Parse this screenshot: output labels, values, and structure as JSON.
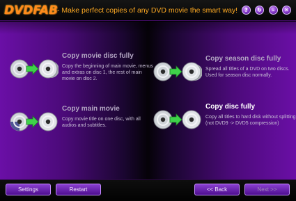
{
  "app": {
    "logo_text": "DVDFAB",
    "tagline": "- Make perfect copies of any DVD movie the smart way!",
    "buttons": {
      "help": "?",
      "refresh": "↻",
      "minimize": "–",
      "close": "✕"
    }
  },
  "options": [
    {
      "title": "Copy movie disc fully",
      "desc": "Copy the beginning of main movie, menus and extras on disc 1, the rest of main movie on disc 2."
    },
    {
      "title": "Copy season disc fully",
      "desc": "Spread all titles of a DVD on two discs. Used for season disc normally."
    },
    {
      "title": "Copy main movie",
      "desc": "Copy movie title on one disc, with all audios and subtitles."
    },
    {
      "title": "Copy disc fully",
      "desc": "Copy all titles to hard disk without splitting (not DVD9 -> DVD5 compression)"
    }
  ],
  "bottom": {
    "settings": "Settings",
    "restart": "Restart",
    "back": "<< Back",
    "next": "Next >>"
  },
  "colors": {
    "accent": "#ff8a1c",
    "panel_purple": "#6a0fa6",
    "arrow_green": "#3fd24a"
  },
  "icons": {
    "disc": "dvd-disc-icon",
    "arrow": "green-arrow-icon"
  }
}
